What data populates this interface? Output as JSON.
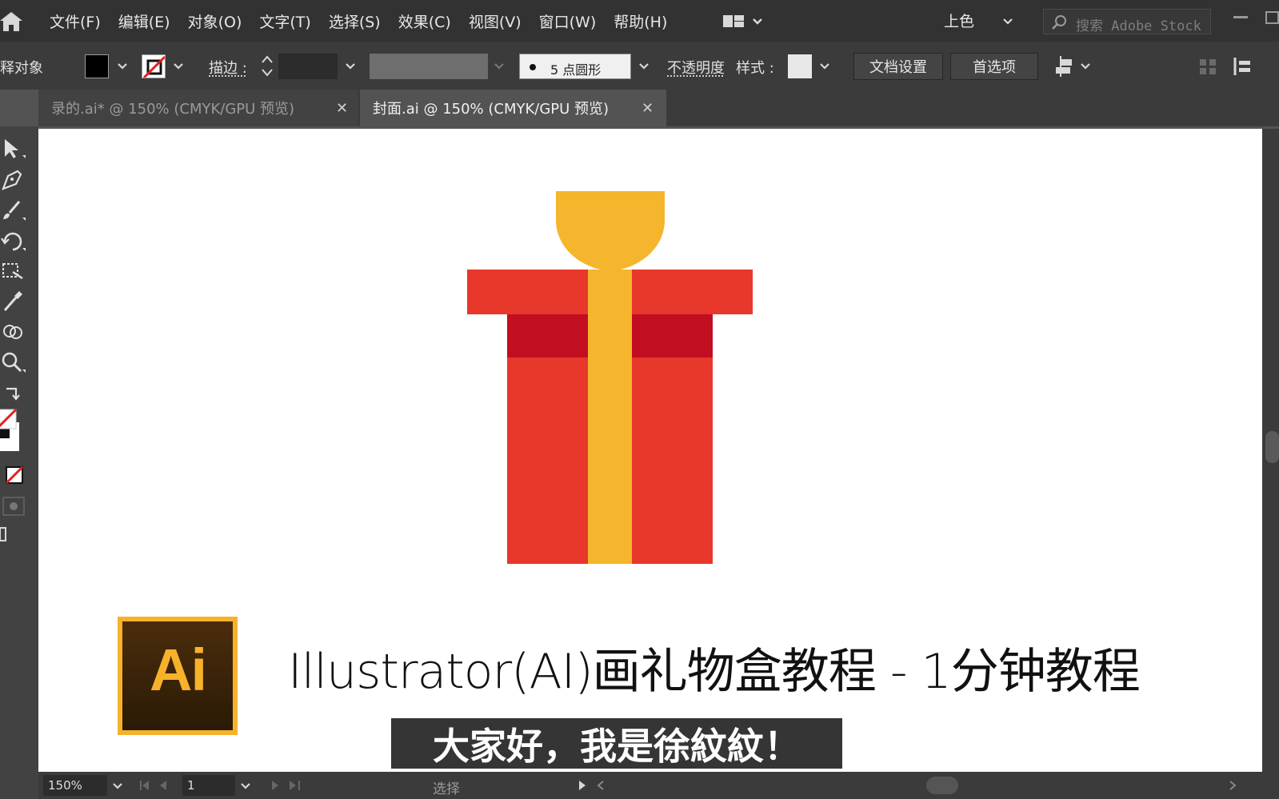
{
  "menu": {
    "items": [
      "文件(F)",
      "编辑(E)",
      "对象(O)",
      "文字(T)",
      "选择(S)",
      "效果(C)",
      "视图(V)",
      "窗口(W)",
      "帮助(H)"
    ],
    "workspace": "上色",
    "search_placeholder": "搜索 Adobe Stock"
  },
  "control": {
    "selection_label": "释对象",
    "stroke_label": "描边 :",
    "brush_label": "5 点圆形",
    "opacity_label": "不透明度",
    "style_label": "样式 :",
    "doc_setup": "文档设置",
    "preferences": "首选项",
    "fill_color": "#000000"
  },
  "tabs": [
    {
      "label": "录的.ai* @ 150% (CMYK/GPU 预览)",
      "active": false
    },
    {
      "label": "封面.ai @ 150% (CMYK/GPU 预览)",
      "active": true
    }
  ],
  "artwork": {
    "colors": {
      "red": "#e8372b",
      "dark_red": "#c10e21",
      "ribbon": "#f5b52c"
    }
  },
  "caption": {
    "logo_text": "Ai",
    "title": "Illustrator(AI)画礼物盒教程 - 1分钟教程",
    "subtitle": "大家好，我是徐紋紋！"
  },
  "status": {
    "zoom": "150%",
    "artboard": "1",
    "tool": "选择"
  }
}
